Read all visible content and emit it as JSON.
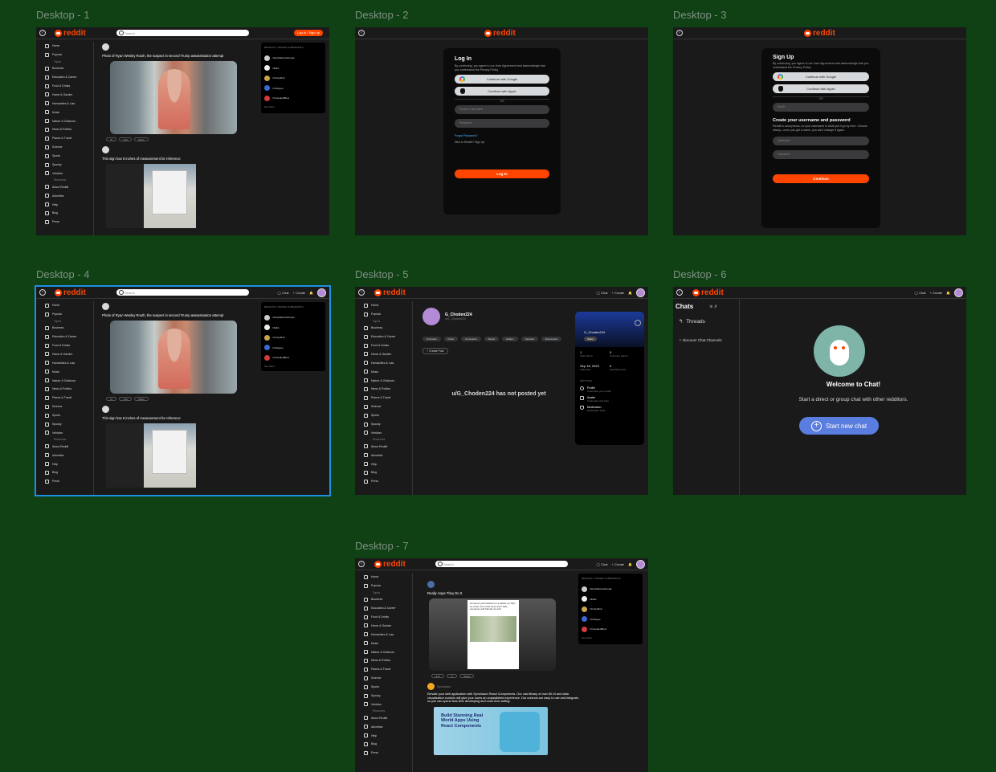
{
  "frames": [
    {
      "label": "Desktop - 1"
    },
    {
      "label": "Desktop - 2"
    },
    {
      "label": "Desktop - 3"
    },
    {
      "label": "Desktop - 4"
    },
    {
      "label": "Desktop - 5"
    },
    {
      "label": "Desktop - 6"
    },
    {
      "label": "Desktop - 7"
    }
  ],
  "brand": {
    "logo_text": "reddit",
    "accent": "#ff4500",
    "canvas_bg": "#0f4115",
    "app_bg": "#1a1a1b"
  },
  "topbar": {
    "search_placeholder": "Search",
    "login_label": "Log In / Sign up",
    "chat_label": "Chat",
    "create_label": "Create"
  },
  "sidebar": {
    "top": [
      "Home",
      "Popular"
    ],
    "topics_header": "Topics",
    "topics": [
      "Business",
      "Education & Career",
      "Food & Drinks",
      "Home & Garden",
      "Humanities & Law",
      "Music",
      "Nature & Outdoors",
      "News & Politics",
      "Places & Travel",
      "Science",
      "Sports",
      "Spooky",
      "Vehicles"
    ],
    "resources_header": "Resources",
    "resources": [
      "About Reddit",
      "Advertise",
      "Help",
      "Blog",
      "Press"
    ]
  },
  "feed": {
    "post1_title": "Photo of Ryan Wesley Routh, the suspect in second Trump assassination attempt",
    "post2_title": "This sign has 8 inches of measurement for reference",
    "actions": [
      "7k",
      "1.5k",
      "Share"
    ]
  },
  "recent": {
    "title": "RECENTLY VIEWED SUBREDDITS",
    "see_more": "See More",
    "items": [
      "r/lazyMalwarePeople",
      "r/Edits",
      "r/CrazyMob",
      "r/Collegee",
      "r/UnsealedBlow"
    ]
  },
  "login": {
    "title": "Log In",
    "terms": "By continuing, you agree to our User Agreement and acknowledge that you understand the Privacy Policy.",
    "google": "Continue with Google",
    "apple": "Continue with Apple",
    "or": "OR",
    "email_placeholder": "Email or username",
    "password_placeholder": "Password",
    "forgot": "Forgot Password?",
    "new_to": "New to Reddit? Sign Up",
    "submit": "Log In"
  },
  "signup": {
    "title": "Sign Up",
    "terms": "By continuing, you agree to our User Agreement and acknowledge that you understand the Privacy Policy.",
    "google": "Continue with Google",
    "apple": "Continue with Apple",
    "or": "OR",
    "email_placeholder": "Email",
    "subtitle": "Create your username and password",
    "desc": "Reddit is anonymous, so your username is what you'll go by here. Choose wisely—once you get a name, you can't change it again.",
    "username_placeholder": "Username",
    "password_placeholder": "Password",
    "submit": "Continue"
  },
  "profile": {
    "username": "G_Choden224",
    "handle": "u/G_Choden224",
    "tabs": [
      "Overview",
      "Posts",
      "Comments",
      "Saved",
      "Hidden",
      "Upvoted",
      "Downvoted"
    ],
    "create_post": "Create Post",
    "empty": "u/G_Choden224 has not posted yet",
    "card_name": "G_Choden224",
    "share": "Share",
    "karma": "1",
    "karma_label": "Post Karma",
    "comment_karma": "0",
    "comment_label": "Comment Karma",
    "cake_day": "Sep 18, 2024",
    "cake_label": "Cake Day",
    "gold": "0",
    "gold_label": "Gold Received",
    "settings_label": "SETTINGS",
    "settings": [
      {
        "title": "Profile",
        "sub": "Customize your profile"
      },
      {
        "title": "Avatar",
        "sub": "Customize and style"
      },
      {
        "title": "Moderation",
        "sub": "Moderation Tools"
      }
    ]
  },
  "chat": {
    "header": "Chats",
    "threads": "Threads",
    "discover": "Discover Chat Channels",
    "welcome": "Welcome to Chat!",
    "desc": "Start a direct or group chat with other redditors.",
    "start": "Start new chat"
  },
  "post7": {
    "title": "Really Hope They Do It",
    "tweet": "someone just handed me a folded up \"fifty\" on a trip. From this store and I hate everyone and friends my self.",
    "ad_author": "Syncfusion",
    "ad_text": "Elevate your web application with Syncfusion React Components. Our vast library of over 80 UI and data visualization controls will give your users an unparalleled experience. Our controls are easy to use and integrate, so you can spend less time developing and more time selling.",
    "ad_banner": "Build Stunning Real World Apps Using React Components"
  }
}
